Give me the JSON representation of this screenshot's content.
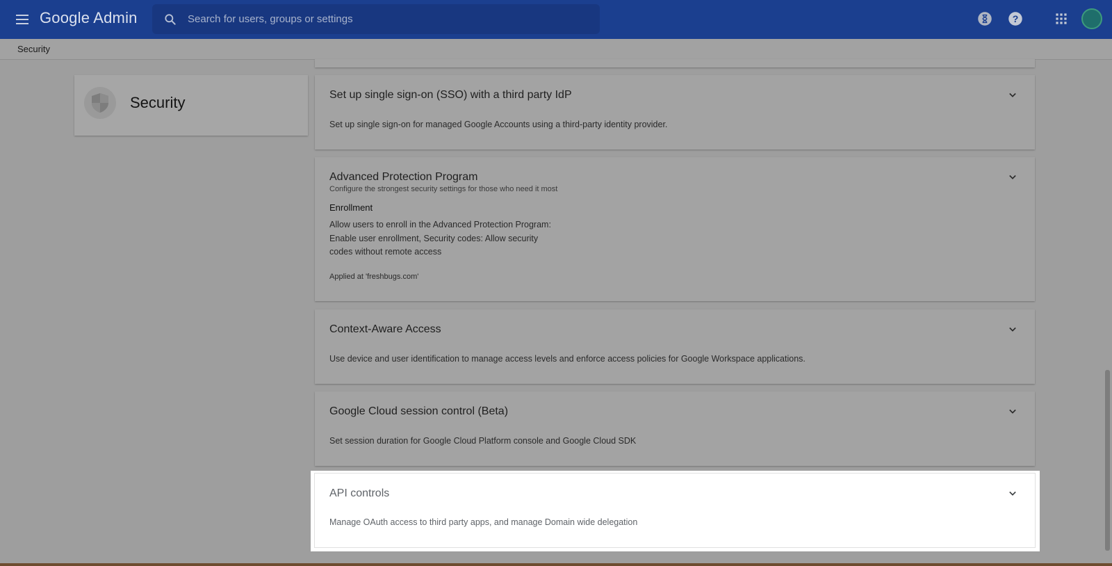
{
  "app": {
    "title": "Google Admin"
  },
  "search": {
    "placeholder": "Search for users, groups or settings"
  },
  "breadcrumb": {
    "current": "Security"
  },
  "left_panel": {
    "title": "Security",
    "icon": "shield-icon"
  },
  "topbar": {
    "icons": [
      "hourglass-icon",
      "help-icon",
      "apps-grid-icon",
      "avatar"
    ]
  },
  "cards": [
    {
      "title": "Set up single sign-on (SSO) with a third party IdP",
      "description": "Set up single sign-on for managed Google Accounts using a third-party identity provider."
    },
    {
      "title": "Advanced Protection Program",
      "subtitle": "Configure the strongest security settings for those who need it most",
      "section_label": "Enrollment",
      "lines": [
        "Allow users to enroll in the Advanced Protection Program:",
        "Enable user enrollment, Security codes: Allow security",
        "codes without remote access"
      ],
      "applied": "Applied at 'freshbugs.com'"
    },
    {
      "title": "Context-Aware Access",
      "description": "Use device and user identification to manage access levels and enforce access policies for Google Workspace applications."
    },
    {
      "title": "Google Cloud session control (Beta)",
      "description": "Set session duration for Google Cloud Platform console and Google Cloud SDK"
    },
    {
      "title": "API controls",
      "description": "Manage OAuth access to third party apps, and manage Domain wide delegation",
      "highlighted": true
    }
  ],
  "colors": {
    "topbar": "#1b3f8f",
    "overlay": "#9e9e9e",
    "highlight": "#ffffff"
  }
}
